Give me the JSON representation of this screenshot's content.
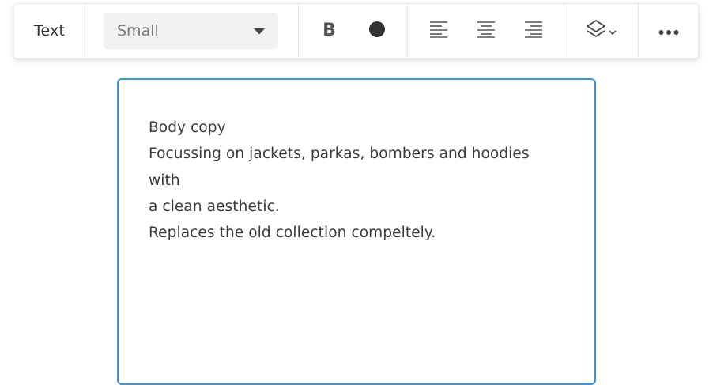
{
  "toolbar": {
    "label": "Text",
    "font_size_select": {
      "value": "Small"
    },
    "icons": {
      "bold": "bold-icon",
      "color": "color-circle-icon",
      "align_left": "align-left-icon",
      "align_center": "align-center-icon",
      "align_right": "align-right-icon",
      "layers": "layers-icon",
      "more": "more-horizontal-icon"
    },
    "bold_glyph": "B",
    "text_color": "#3a3a3a"
  },
  "editor": {
    "lines": [
      "Body copy",
      "Focussing on jackets, parkas, bombers and hoodies with",
      "a clean aesthetic.",
      "Replaces the old collection compeltely."
    ],
    "focus_border_color": "#3d93d6"
  }
}
